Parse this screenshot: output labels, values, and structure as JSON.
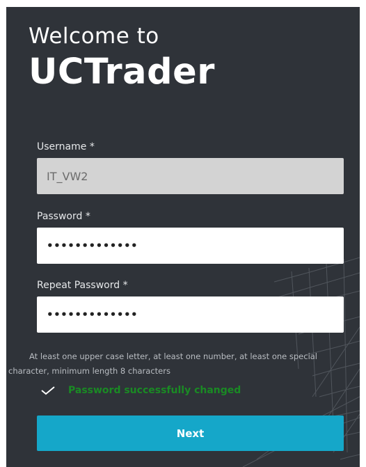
{
  "colors": {
    "panel_bg": "#2f3339",
    "accent": "#15a7c9",
    "success": "#1a8a24",
    "readonly_field": "#d3d3d3"
  },
  "header": {
    "welcome": "Welcome to",
    "brand": "UCTrader"
  },
  "form": {
    "username": {
      "label": "Username *",
      "value": "IT_VW2"
    },
    "password": {
      "label": "Password *",
      "value": "•••••••••••••"
    },
    "repeat_password": {
      "label": "Repeat Password *",
      "value": "•••••••••••••"
    },
    "hint": "At least one upper case letter, at least one number, at least one special character, minimum length 8 characters",
    "success_icon": "checkmark-icon",
    "success": "Password successfully changed",
    "next_label": "Next"
  }
}
